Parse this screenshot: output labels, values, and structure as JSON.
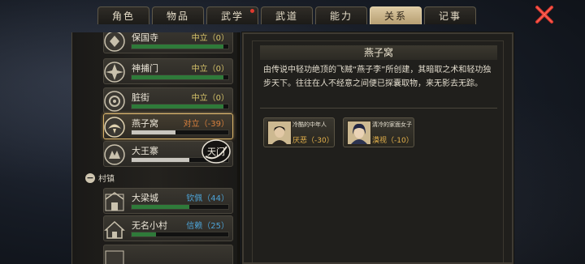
{
  "tabs": [
    {
      "label": "角色",
      "active": false,
      "dot": false
    },
    {
      "label": "物品",
      "active": false,
      "dot": false
    },
    {
      "label": "武学",
      "active": false,
      "dot": true
    },
    {
      "label": "武道",
      "active": false,
      "dot": false
    },
    {
      "label": "能力",
      "active": false,
      "dot": false
    },
    {
      "label": "关系",
      "active": true,
      "dot": false
    },
    {
      "label": "记事",
      "active": false,
      "dot": false
    }
  ],
  "factions": [
    {
      "name": "保国寺",
      "relation": "中立（0）",
      "progress": 0.95,
      "color": "#d7c46a",
      "bar_color": "#2f7a3a"
    },
    {
      "name": "神捕门",
      "relation": "中立（0）",
      "progress": 0.95,
      "color": "#d7c46a",
      "bar_color": "#2f7a3a"
    },
    {
      "name": "脏街",
      "relation": "中立（0）",
      "progress": 0.95,
      "color": "#d7c46a",
      "bar_color": "#2f7a3a"
    },
    {
      "name": "燕子窝",
      "relation": "对立（-39）",
      "progress": 0.45,
      "color": "#d9803e",
      "bar_color": "#c9c6bf",
      "selected": true
    },
    {
      "name": "大王寨",
      "relation": "",
      "progress": 0.6,
      "color": "#d7c46a",
      "bar_color": "#c9c6bf"
    }
  ],
  "section": {
    "label": "村镇"
  },
  "towns": [
    {
      "name": "大梁城",
      "relation": "钦佩（44）",
      "progress": 0.6,
      "color": "#4da3d6",
      "bar_color": "#2f7a3a"
    },
    {
      "name": "无名小村",
      "relation": "信赖（25）",
      "progress": 0.25,
      "color": "#4da3d6",
      "bar_color": "#2f7a3a"
    }
  ],
  "hint_icon": {
    "label": "天门"
  },
  "detail": {
    "title": "燕子窝",
    "description": "由传说中轻功绝顶的飞贼“燕子李”所创建，其暗取之术和轻功独步天下。往往在人不经意之间便已探囊取物，来无影去无踪。",
    "npcs": [
      {
        "name": "冷酷的中年人",
        "relation": "厌恶（-30）"
      },
      {
        "name": "清冷的家面女子",
        "relation": "漠视（-10）"
      }
    ]
  },
  "icons": {
    "close": "close-x-icon",
    "faction_emblem": "faction-emblem-icon"
  },
  "colors": {
    "accent": "#d9b36a",
    "close": "#e03a2f"
  }
}
